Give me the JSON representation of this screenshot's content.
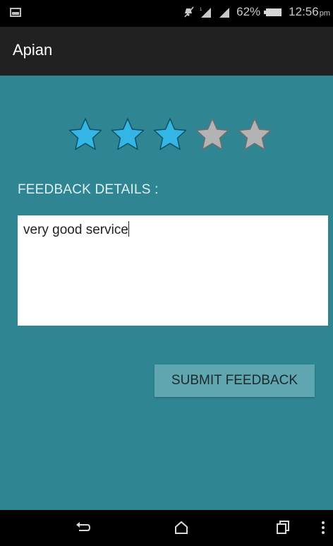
{
  "status_bar": {
    "battery_percent": "62%",
    "time": "12:56",
    "time_suffix": "pm",
    "icons": [
      "gallery-notification-icon",
      "mute-icon",
      "signal-icon",
      "signal-icon",
      "battery-icon"
    ]
  },
  "app": {
    "title": "Apian"
  },
  "rating": {
    "value": 3,
    "max": 5,
    "filled_color": "#33b5e5",
    "empty_color": "#b3b3b3"
  },
  "feedback": {
    "label": "FEEDBACK DETAILS :",
    "value": "very good service"
  },
  "submit": {
    "label": "SUBMIT FEEDBACK"
  },
  "nav_bar": {
    "icons": [
      "back-icon",
      "home-icon",
      "recents-icon",
      "overflow-menu-icon"
    ]
  },
  "colors": {
    "background": "#308593",
    "action_bar": "#212121",
    "button": "#60a6b0"
  }
}
